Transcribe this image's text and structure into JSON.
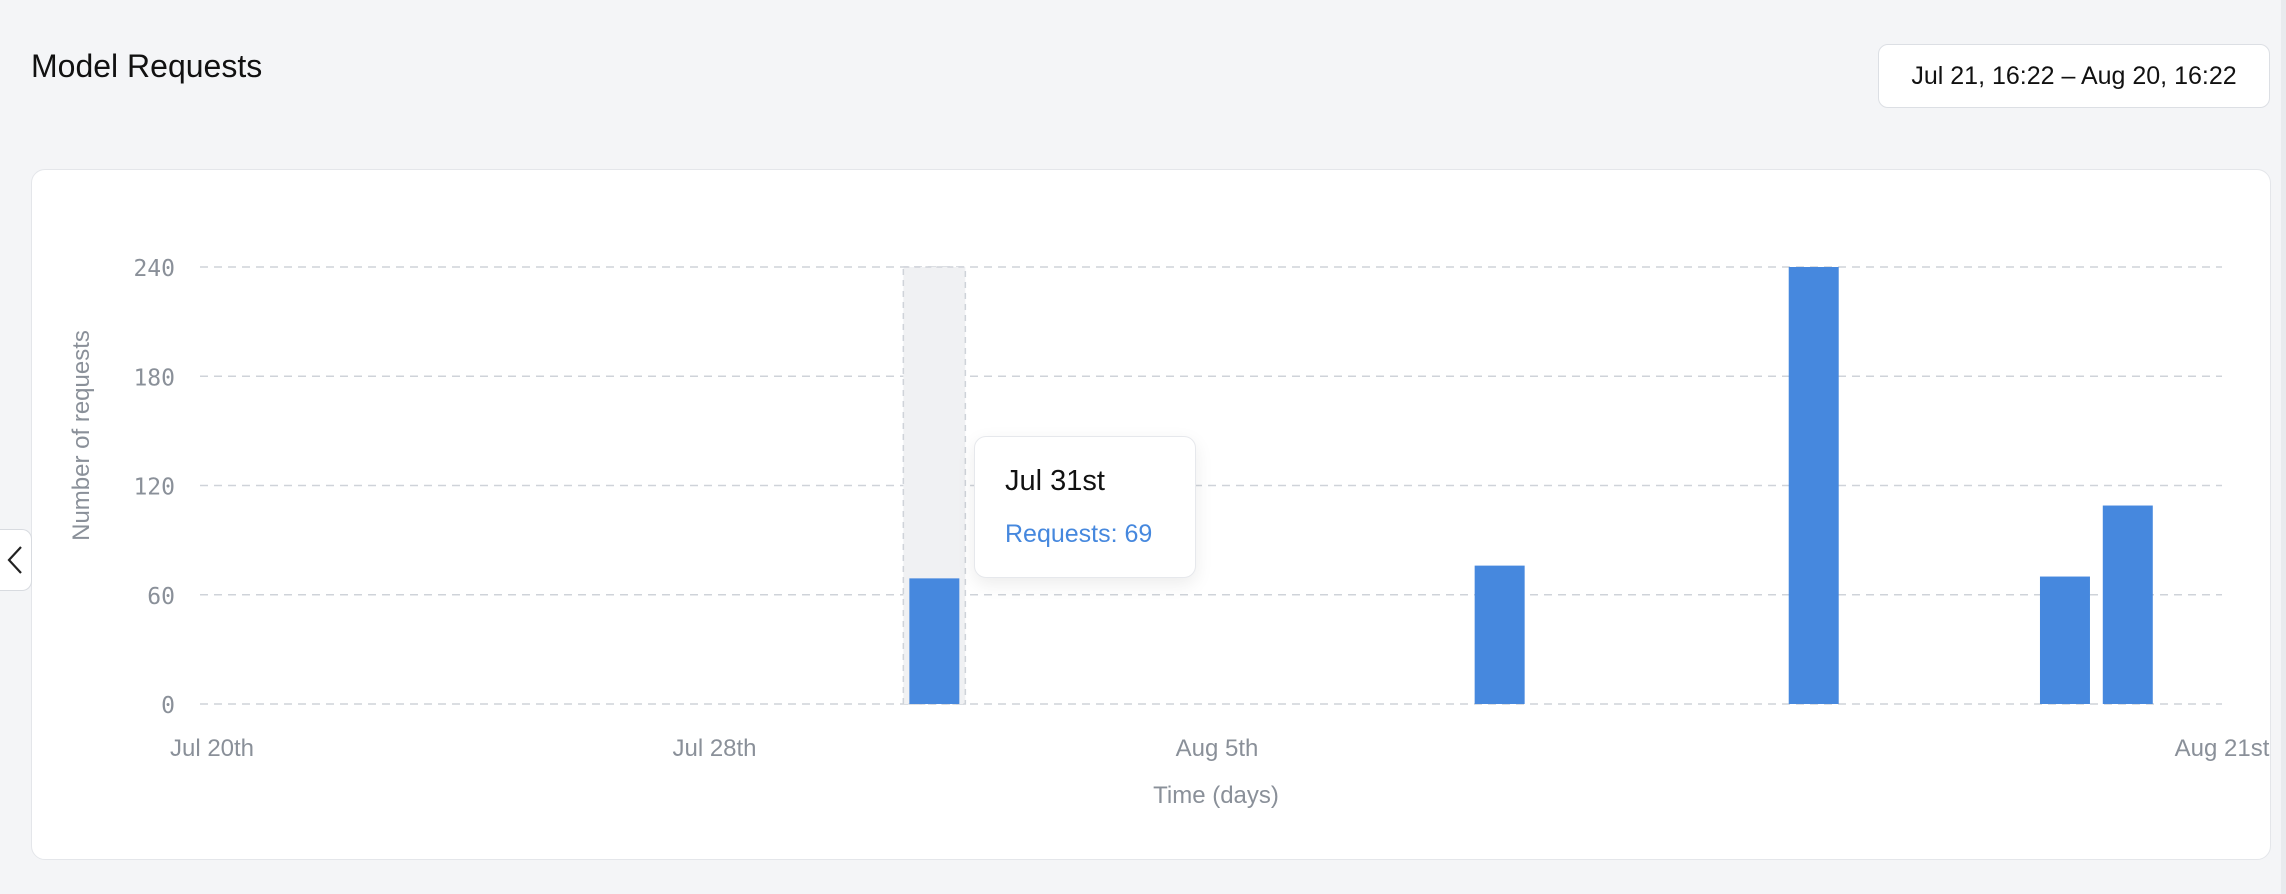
{
  "page": {
    "title": "Model Requests",
    "date_range": "Jul 21, 16:22 – Aug 20, 16:22"
  },
  "colors": {
    "bar": "#4688de",
    "grid": "#cfd3d9",
    "axis_text": "#8a9099",
    "highlight": "#f0f1f3"
  },
  "icons": {
    "collapse": "chevron-left-icon"
  },
  "tooltip": {
    "title": "Jul 31st",
    "label": "Requests",
    "value": 69,
    "line": "Requests: 69"
  },
  "chart_data": {
    "type": "bar",
    "title": "",
    "xlabel": "Time (days)",
    "ylabel": "Number of requests",
    "ylim": [
      0,
      240
    ],
    "yticks": [
      0,
      60,
      120,
      180,
      240
    ],
    "xlim": [
      "2023-07-20",
      "2023-08-21"
    ],
    "xticks": [
      {
        "date": "2023-07-20",
        "label": "Jul 20th"
      },
      {
        "date": "2023-07-28",
        "label": "Jul 28th"
      },
      {
        "date": "2023-08-05",
        "label": "Aug 5th"
      },
      {
        "date": "2023-08-21",
        "label": "Aug 21st"
      }
    ],
    "grid": true,
    "bars": [
      {
        "date": "2023-07-31",
        "value": 69
      },
      {
        "date": "2023-08-09",
        "value": 76
      },
      {
        "date": "2023-08-14",
        "value": 240
      },
      {
        "date": "2023-08-18",
        "value": 70
      },
      {
        "date": "2023-08-19",
        "value": 109
      }
    ],
    "highlighted_date": "2023-07-31"
  }
}
